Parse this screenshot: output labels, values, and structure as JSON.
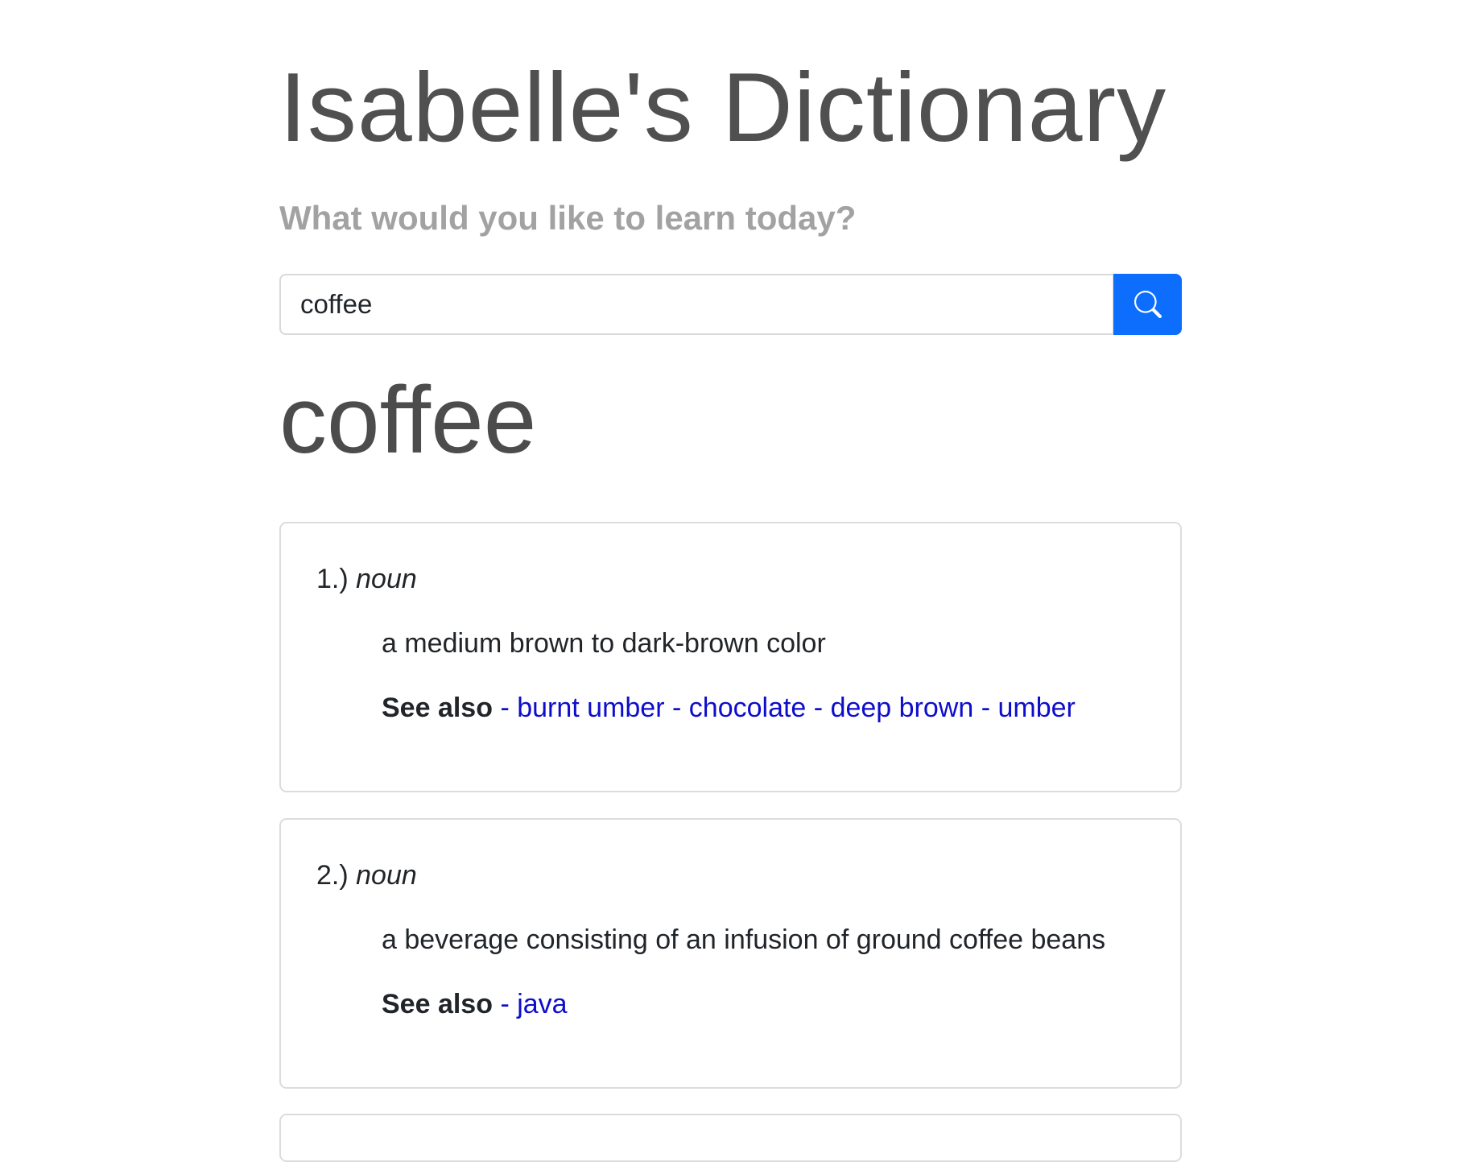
{
  "header": {
    "title": "Isabelle's Dictionary",
    "subtitle": "What would you like to learn today?"
  },
  "search": {
    "value": "coffee",
    "button_icon": "search-icon",
    "button_color": "#0d6efd"
  },
  "result": {
    "word": "coffee",
    "meanings": [
      {
        "number": "1.)",
        "part_of_speech": "noun",
        "definition": "a medium brown to dark-brown color",
        "see_also_label": "See also",
        "synonyms": [
          "burnt umber",
          "chocolate",
          "deep brown",
          "umber"
        ]
      },
      {
        "number": "2.)",
        "part_of_speech": "noun",
        "definition": "a beverage consisting of an infusion of ground coffee beans",
        "see_also_label": "See also",
        "synonyms": [
          "java"
        ]
      }
    ]
  },
  "colors": {
    "link": "#0d0dcc",
    "title": "#505050",
    "subtitle": "#a2a2a2"
  }
}
